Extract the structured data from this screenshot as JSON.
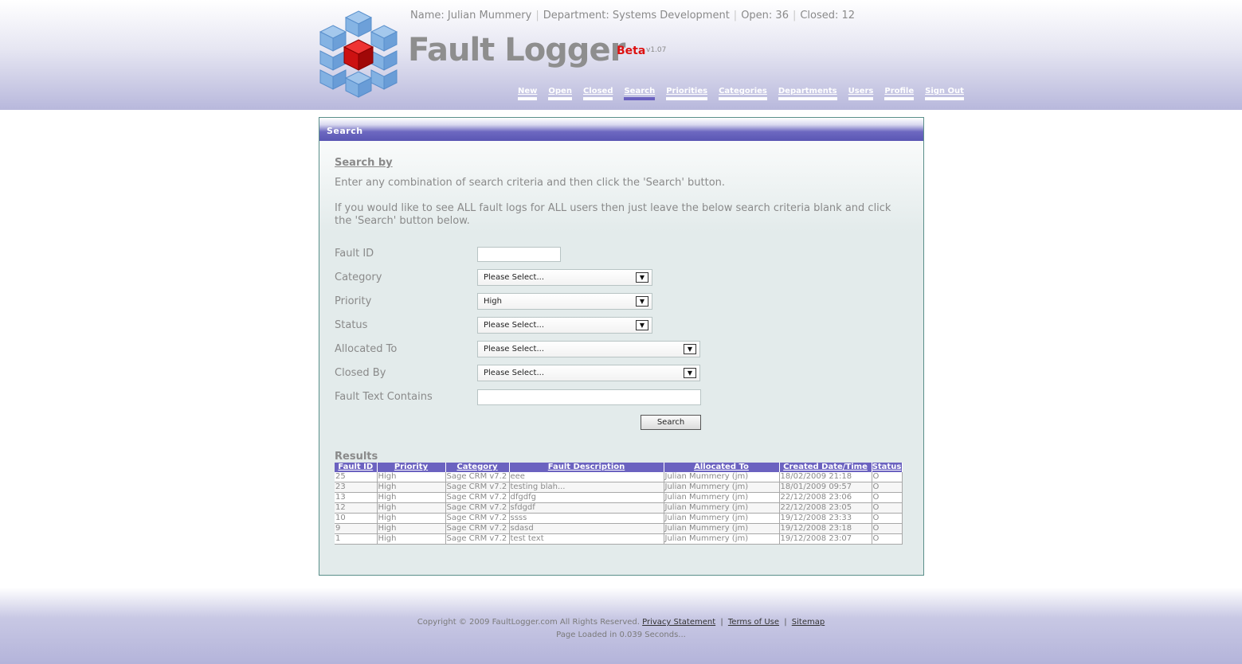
{
  "header": {
    "user_name": "Name: Julian Mummery",
    "department": "Department: Systems Development",
    "open": "Open: 36",
    "closed": "Closed: 12",
    "separator": "|",
    "app_title": "Fault Logger",
    "beta": "Beta",
    "version": "v1.07"
  },
  "nav": [
    "New",
    "Open",
    "Closed",
    "Search",
    "Priorities",
    "Categories",
    "Departments",
    "Users",
    "Profile",
    "Sign Out"
  ],
  "nav_active": "Search",
  "panel": {
    "title": "Search",
    "search_by": "Search by",
    "para1": "Enter any combination of search criteria and then click the 'Search' button.",
    "para2": "If you would like to see ALL fault logs for ALL users then just leave the below search criteria blank and click the 'Search' button below."
  },
  "form": {
    "fault_id_label": "Fault ID",
    "fault_id_value": "",
    "category_label": "Category",
    "category_value": "Please Select...",
    "priority_label": "Priority",
    "priority_value": "High",
    "status_label": "Status",
    "status_value": "Please Select...",
    "allocated_label": "Allocated To",
    "allocated_value": "Please Select...",
    "closed_by_label": "Closed By",
    "closed_by_value": "Please Select...",
    "fault_text_label": "Fault Text Contains",
    "fault_text_value": "",
    "search_button": "Search",
    "arrow": "▼"
  },
  "results": {
    "title": "Results",
    "columns": [
      "Fault ID",
      "Priority",
      "Category",
      "Fault Description",
      "Allocated To",
      "Created Date/Time",
      "Status"
    ],
    "rows": [
      [
        "25",
        "High",
        "Sage CRM v7.2",
        "eee",
        "Julian Mummery (jm)",
        "18/02/2009 21:18",
        "O"
      ],
      [
        "23",
        "High",
        "Sage CRM v7.2",
        "testing blah...",
        "Julian Mummery (jm)",
        "18/01/2009 09:57",
        "O"
      ],
      [
        "13",
        "High",
        "Sage CRM v7.2",
        "dfgdfg",
        "Julian Mummery (jm)",
        "22/12/2008 23:06",
        "O"
      ],
      [
        "12",
        "High",
        "Sage CRM v7.2",
        "sfdgdf",
        "Julian Mummery (jm)",
        "22/12/2008 23:05",
        "O"
      ],
      [
        "10",
        "High",
        "Sage CRM v7.2",
        "ssss",
        "Julian Mummery (jm)",
        "19/12/2008 23:33",
        "O"
      ],
      [
        "9",
        "High",
        "Sage CRM v7.2",
        "sdasd",
        "Julian Mummery (jm)",
        "19/12/2008 23:18",
        "O"
      ],
      [
        "1",
        "High",
        "Sage CRM v7.2",
        "test text",
        "Julian Mummery (jm)",
        "19/12/2008 23:07",
        "O"
      ]
    ]
  },
  "footer": {
    "copyright": "Copyright © 2009 FaultLogger.com All Rights Reserved.",
    "privacy": "Privacy Statement",
    "terms": "Terms of Use",
    "sitemap": "Sitemap",
    "separator": "|",
    "load_time": "Page Loaded in 0.039 Seconds..."
  },
  "colors": {
    "accent": "#6b62c0",
    "beta": "#dd1111",
    "logo_red": "#cc1111",
    "logo_blue": "#6fa6dc"
  }
}
